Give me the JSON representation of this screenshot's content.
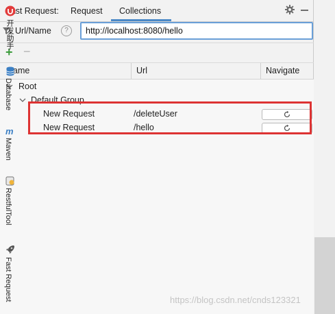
{
  "header": {
    "title": "Fast Request:",
    "tabs": [
      {
        "label": "Request",
        "active": false
      },
      {
        "label": "Collections",
        "active": true
      }
    ]
  },
  "url_bar": {
    "label": "Url/Name",
    "value": "http://localhost:8080/hello"
  },
  "toolbar": {
    "add": "+",
    "remove": "−"
  },
  "table": {
    "columns": [
      "Name",
      "Url",
      "Navigate"
    ]
  },
  "tree": {
    "root": "Root",
    "group": "Default Group",
    "requests": [
      {
        "name": "New Request",
        "url": "/deleteUser"
      },
      {
        "name": "New Request",
        "url": "/hello"
      }
    ]
  },
  "sidebar": {
    "items": [
      {
        "label": "开发助手",
        "icon": "dev-assistant-icon"
      },
      {
        "label": "Database",
        "icon": "database-icon"
      },
      {
        "label": "Maven",
        "icon": "maven-icon"
      },
      {
        "label": "RestfulTool",
        "icon": "restfultool-icon"
      },
      {
        "label": "Fast Request",
        "icon": "rocket-icon"
      }
    ]
  },
  "watermark": "https://blog.csdn.net/cnds123321",
  "colors": {
    "accent": "#4a88c7",
    "highlight_box": "#dd3333",
    "add_green": "#3b9b3b"
  }
}
